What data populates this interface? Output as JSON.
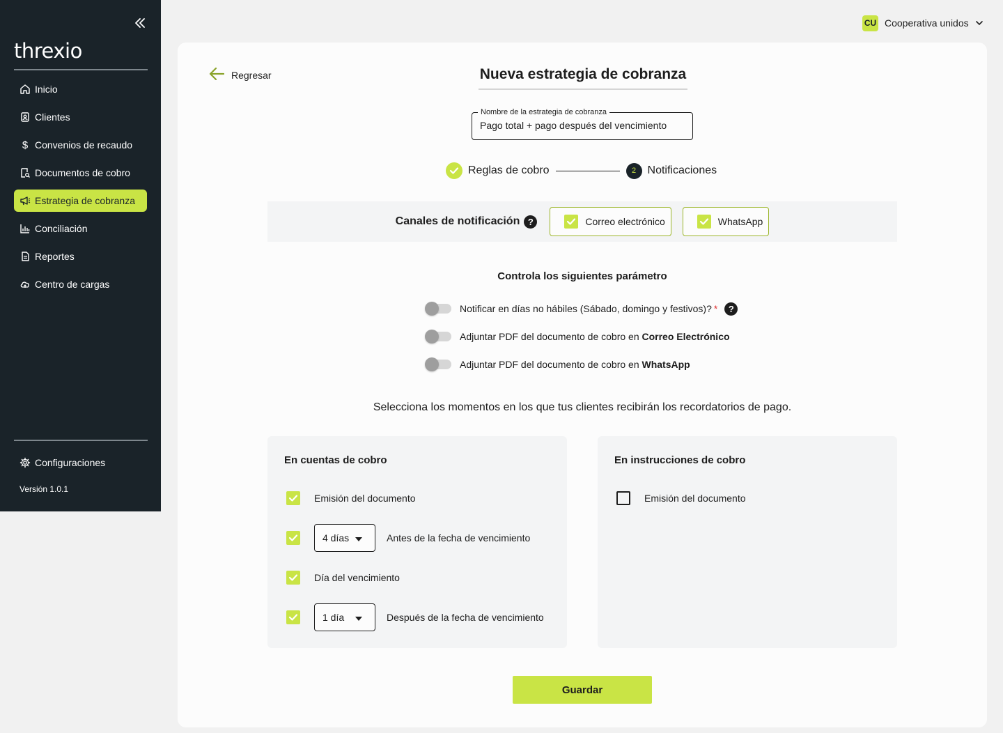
{
  "sidebar": {
    "logo": "threxio",
    "items": [
      {
        "label": "Inicio",
        "icon": "home-icon"
      },
      {
        "label": "Clientes",
        "icon": "contacts-icon"
      },
      {
        "label": "Convenios de recaudo",
        "icon": "dollar-icon"
      },
      {
        "label": "Documentos de cobro",
        "icon": "document-search-icon"
      },
      {
        "label": "Estrategia de cobranza",
        "icon": "megaphone-icon",
        "active": true
      },
      {
        "label": "Conciliación",
        "icon": "bar-chart-icon"
      },
      {
        "label": "Reportes",
        "icon": "report-icon"
      },
      {
        "label": "Centro de cargas",
        "icon": "cloud-upload-icon"
      }
    ],
    "config_label": "Configuraciones",
    "version": "Versión 1.0.1"
  },
  "topbar": {
    "org_initials": "CU",
    "org_name": "Cooperativa unidos"
  },
  "main": {
    "back_label": "Regresar",
    "title": "Nueva estrategia de cobranza",
    "name_field": {
      "label": "Nombre de la estrategia de cobranza",
      "value": "Pago total + pago después del vencimiento"
    },
    "stepper": {
      "step1": "Reglas de cobro",
      "step2_number": "2",
      "step2": "Notificaciones"
    },
    "channels": {
      "label": "Canales de notificación",
      "help": "?",
      "email": "Correo electrónico",
      "whatsapp": "WhatsApp"
    },
    "params": {
      "title": "Controla los siguientes parámetro",
      "nonworking": "Notificar en días no hábiles (Sábado, domingo y festivos)?",
      "required_mark": "*",
      "pdf_email_prefix": "Adjuntar PDF del documento de cobro en ",
      "pdf_email_bold": "Correo Electrónico",
      "pdf_whatsapp_prefix": "Adjuntar PDF del documento de cobro en ",
      "pdf_whatsapp_bold": "WhatsApp"
    },
    "moments_text": "Selecciona los momentos en los que tus clientes recibirán los recordatorios de pago.",
    "accounts_panel": {
      "title": "En cuentas de cobro",
      "emission": "Emisión del documento",
      "before_value": "4 días",
      "before_text": "Antes de la fecha de vencimiento",
      "due_day": "Día del vencimiento",
      "after_value": "1 día",
      "after_text": "Después de la fecha de vencimiento"
    },
    "instructions_panel": {
      "title": "En instrucciones de cobro",
      "emission": "Emisión del documento"
    },
    "save_label": "Guardar"
  },
  "colors": {
    "accent": "#c9e445",
    "sidebar_bg": "#1a2329"
  }
}
